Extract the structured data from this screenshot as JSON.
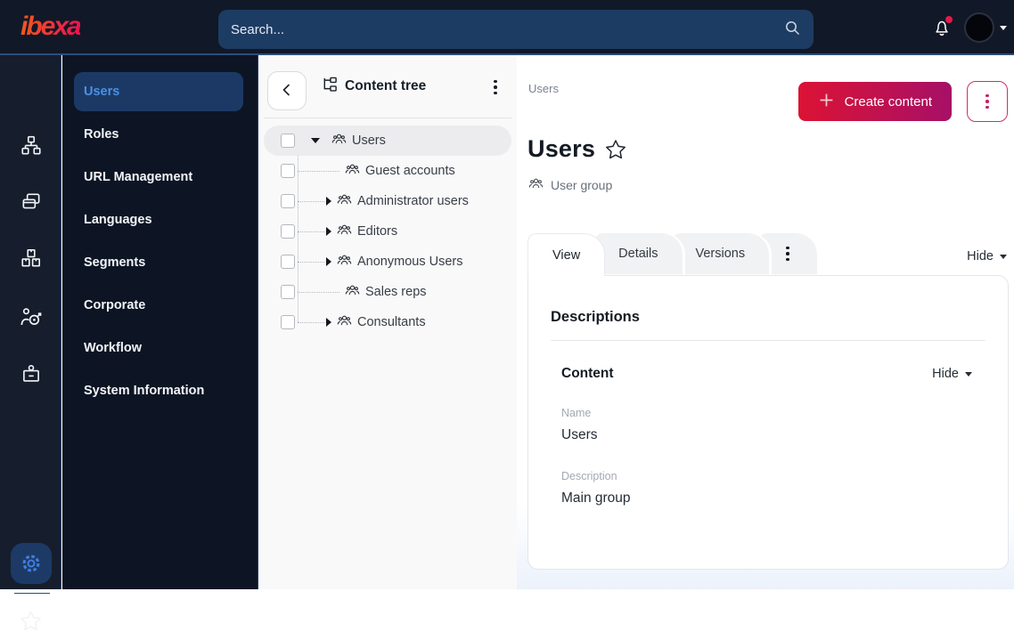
{
  "topbar": {
    "logo_text": "ibexa",
    "search_placeholder": "Search...",
    "icons": [
      "search-icon",
      "bell-icon",
      "avatar",
      "caret-down-icon"
    ],
    "notification_badge_color": "#e8174a"
  },
  "rail": {
    "icons": [
      "sitemap-icon",
      "pages-icon",
      "boxes-icon",
      "audience-target-icon",
      "id-badge-icon",
      "gear-icon",
      "star-icon"
    ],
    "active_icon": "gear-icon"
  },
  "nav": {
    "items": [
      {
        "label": "Users",
        "active": true
      },
      {
        "label": "Roles"
      },
      {
        "label": "URL Management"
      },
      {
        "label": "Languages"
      },
      {
        "label": "Segments"
      },
      {
        "label": "Corporate"
      },
      {
        "label": "Workflow"
      },
      {
        "label": "System Information"
      }
    ]
  },
  "tree": {
    "title": "Content tree",
    "items": [
      {
        "label": "Users",
        "state": "expanded",
        "selected": true,
        "level": 0
      },
      {
        "label": "Guest accounts",
        "state": "leaf",
        "level": 1
      },
      {
        "label": "Administrator users",
        "state": "collapsed",
        "level": 1
      },
      {
        "label": "Editors",
        "state": "collapsed",
        "level": 1
      },
      {
        "label": "Anonymous Users",
        "state": "collapsed",
        "level": 1
      },
      {
        "label": "Sales reps",
        "state": "leaf",
        "level": 1
      },
      {
        "label": "Consultants",
        "state": "collapsed",
        "level": 1
      }
    ]
  },
  "main": {
    "breadcrumb": "Users",
    "create_button_label": "Create content",
    "title": "Users",
    "content_type_label": "User group",
    "tabs": [
      {
        "label": "View",
        "active": true
      },
      {
        "label": "Details"
      },
      {
        "label": "Versions"
      }
    ],
    "hide_label": "Hide",
    "card": {
      "heading": "Descriptions",
      "section_title": "Content",
      "section_hide_label": "Hide",
      "fields": [
        {
          "label": "Name",
          "value": "Users"
        },
        {
          "label": "Description",
          "value": "Main group"
        }
      ]
    }
  },
  "colors": {
    "accent_gradient_start": "#dc1334",
    "accent_gradient_end": "#a61067",
    "topbar_bg": "#111827",
    "nav_bg": "#0d1524",
    "selected_nav_text": "#4a90e2",
    "notification_badge": "#e8174a"
  }
}
